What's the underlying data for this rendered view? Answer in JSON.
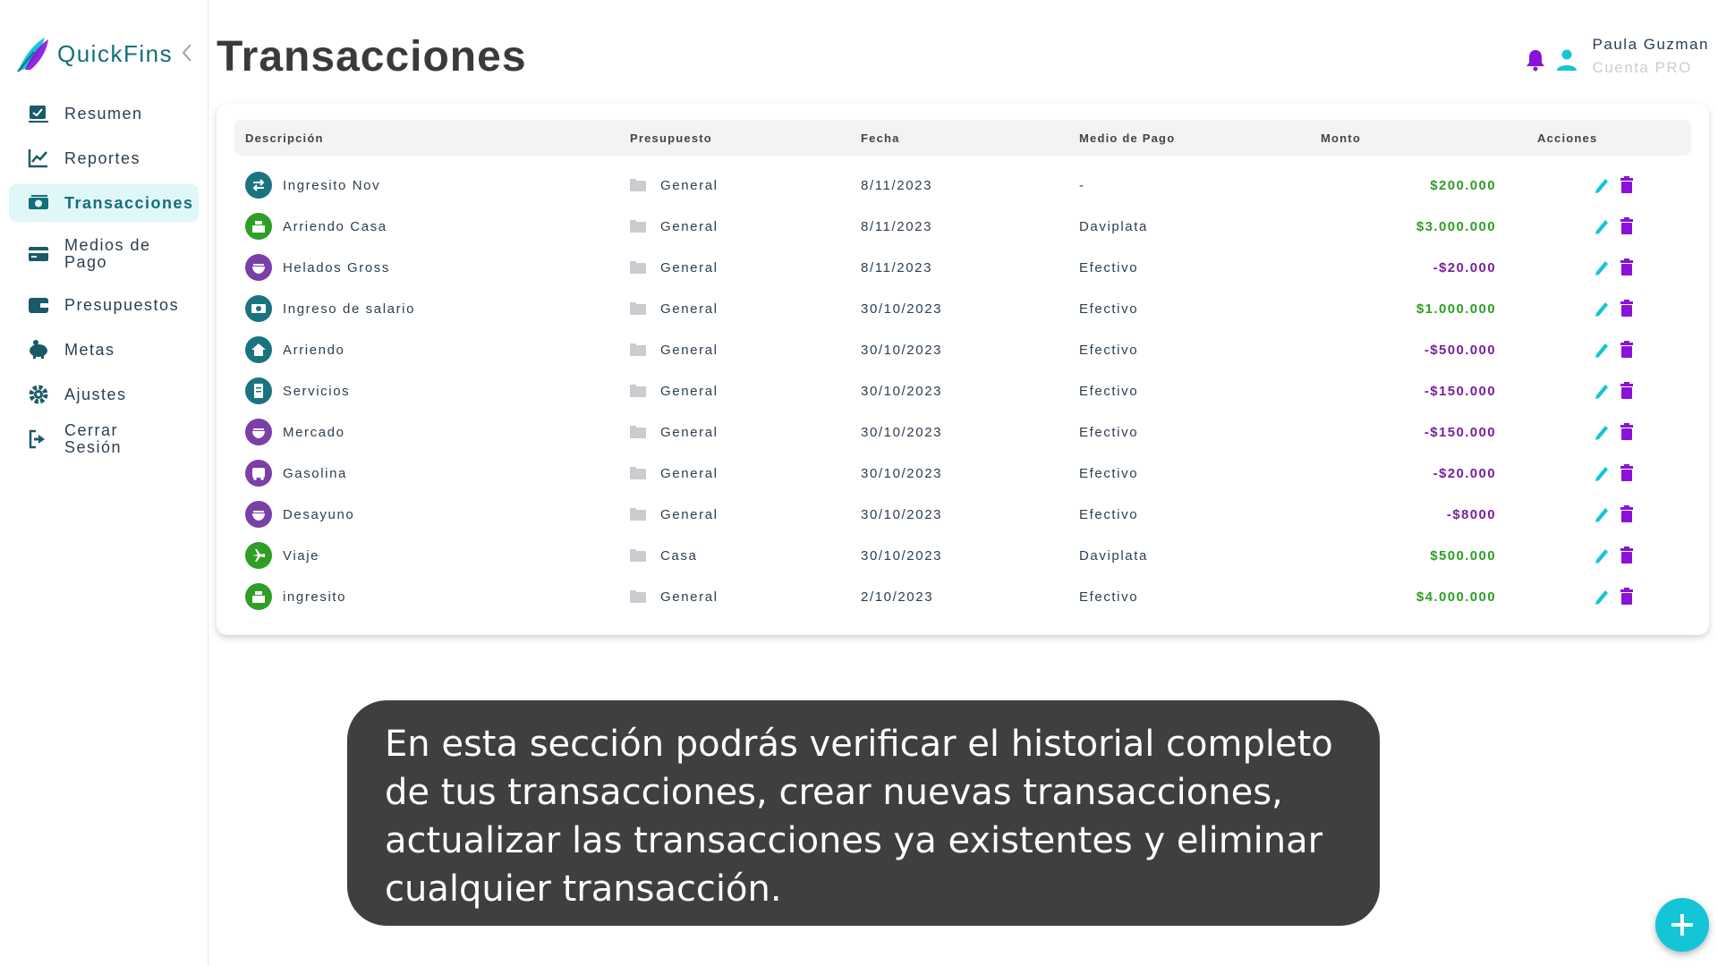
{
  "app": {
    "name": "QuickFins"
  },
  "colors": {
    "teal": "#136f7a",
    "cyan": "#14c5d8",
    "purple": "#8b12d8",
    "green": "#2e9e26",
    "negative": "#7a1f9c"
  },
  "sidebar": {
    "items": [
      {
        "label": "Resumen",
        "icon": "chart-check-icon"
      },
      {
        "label": "Reportes",
        "icon": "line-chart-icon"
      },
      {
        "label": "Transacciones",
        "icon": "money-icon",
        "active": true
      },
      {
        "label": "Medios de Pago",
        "icon": "credit-card-icon"
      },
      {
        "label": "Presupuestos",
        "icon": "wallet-icon"
      },
      {
        "label": "Metas",
        "icon": "piggy-bank-icon"
      },
      {
        "label": "Ajustes",
        "icon": "gear-icon"
      },
      {
        "label": "Cerrar Sesión",
        "icon": "logout-icon"
      }
    ]
  },
  "header": {
    "title": "Transacciones",
    "user": {
      "name": "Paula Guzman",
      "plan": "Cuenta PRO"
    }
  },
  "table": {
    "columns": [
      "Descripción",
      "Presupuesto",
      "Fecha",
      "Medio de Pago",
      "Monto",
      "Acciones"
    ],
    "rows": [
      {
        "description": "Ingresito Nov",
        "budget": "General",
        "date": "8/11/2023",
        "payment": "-",
        "amount": "$200.000",
        "icon": "exchange-icon",
        "iconColor": "#1a7480",
        "positive": true
      },
      {
        "description": "Arriendo Casa",
        "budget": "General",
        "date": "8/11/2023",
        "payment": "Daviplata",
        "amount": "$3.000.000",
        "icon": "cash-register-icon",
        "iconColor": "#2e9e26",
        "positive": true
      },
      {
        "description": "Helados Gross",
        "budget": "General",
        "date": "8/11/2023",
        "payment": "Efectivo",
        "amount": "-$20.000",
        "icon": "food-bowl-icon",
        "iconColor": "#7b3fa8",
        "positive": false
      },
      {
        "description": "Ingreso de salario",
        "budget": "General",
        "date": "30/10/2023",
        "payment": "Efectivo",
        "amount": "$1.000.000",
        "icon": "banknote-icon",
        "iconColor": "#1a7480",
        "positive": true
      },
      {
        "description": "Arriendo",
        "budget": "General",
        "date": "30/10/2023",
        "payment": "Efectivo",
        "amount": "-$500.000",
        "icon": "house-icon",
        "iconColor": "#1a7480",
        "positive": false
      },
      {
        "description": "Servicios",
        "budget": "General",
        "date": "30/10/2023",
        "payment": "Efectivo",
        "amount": "-$150.000",
        "icon": "receipt-icon",
        "iconColor": "#1a7480",
        "positive": false
      },
      {
        "description": "Mercado",
        "budget": "General",
        "date": "30/10/2023",
        "payment": "Efectivo",
        "amount": "-$150.000",
        "icon": "food-bowl-icon",
        "iconColor": "#7b3fa8",
        "positive": false
      },
      {
        "description": "Gasolina",
        "budget": "General",
        "date": "30/10/2023",
        "payment": "Efectivo",
        "amount": "-$20.000",
        "icon": "bus-icon",
        "iconColor": "#7b3fa8",
        "positive": false
      },
      {
        "description": "Desayuno",
        "budget": "General",
        "date": "30/10/2023",
        "payment": "Efectivo",
        "amount": "-$8000",
        "icon": "food-bowl-icon",
        "iconColor": "#7b3fa8",
        "positive": false
      },
      {
        "description": "Viaje",
        "budget": "Casa",
        "date": "30/10/2023",
        "payment": "Daviplata",
        "amount": "$500.000",
        "icon": "plane-icon",
        "iconColor": "#2e9e26",
        "positive": true
      },
      {
        "description": "ingresito",
        "budget": "General",
        "date": "2/10/2023",
        "payment": "Efectivo",
        "amount": "$4.000.000",
        "icon": "cash-register-icon",
        "iconColor": "#2e9e26",
        "positive": true
      }
    ]
  },
  "tooltip": {
    "text": "En esta sección podrás verificar el historial completo de tus transacciones, crear nuevas transacciones, actualizar las transacciones ya existentes y eliminar cualquier transacción."
  }
}
